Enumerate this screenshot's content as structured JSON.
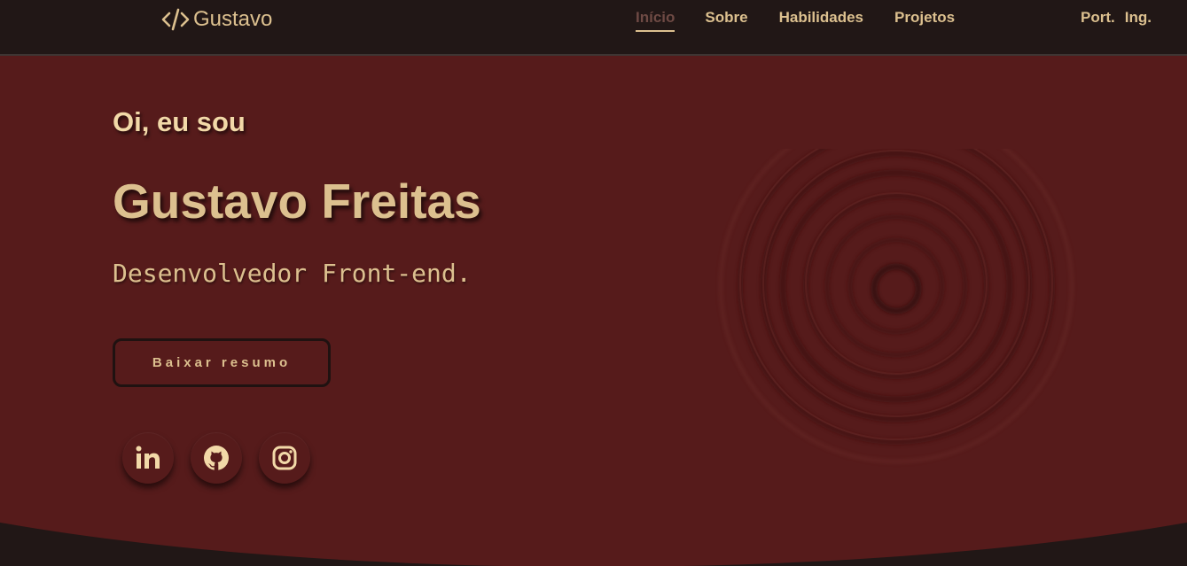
{
  "brand": {
    "icon": "code-icon",
    "name": "Gustavo"
  },
  "nav": {
    "items": [
      {
        "label": "Início",
        "active": true
      },
      {
        "label": "Sobre",
        "active": false
      },
      {
        "label": "Habilidades",
        "active": false
      },
      {
        "label": "Projetos",
        "active": false
      }
    ]
  },
  "language": {
    "options": [
      "Port.",
      "Ing."
    ]
  },
  "hero": {
    "greeting": "Oi, eu sou",
    "name": "Gustavo Freitas",
    "role": "Desenvolvedor Front-end.",
    "resume_button": "Baixar resumo",
    "socials": [
      {
        "icon": "linkedin-icon"
      },
      {
        "icon": "github-icon"
      },
      {
        "icon": "instagram-icon"
      }
    ]
  },
  "colors": {
    "background": "#211716",
    "hero": "#561b1b",
    "accent": "#dcc08f",
    "greeting": "#f2d9a8",
    "active_nav": "#6e4a44"
  }
}
